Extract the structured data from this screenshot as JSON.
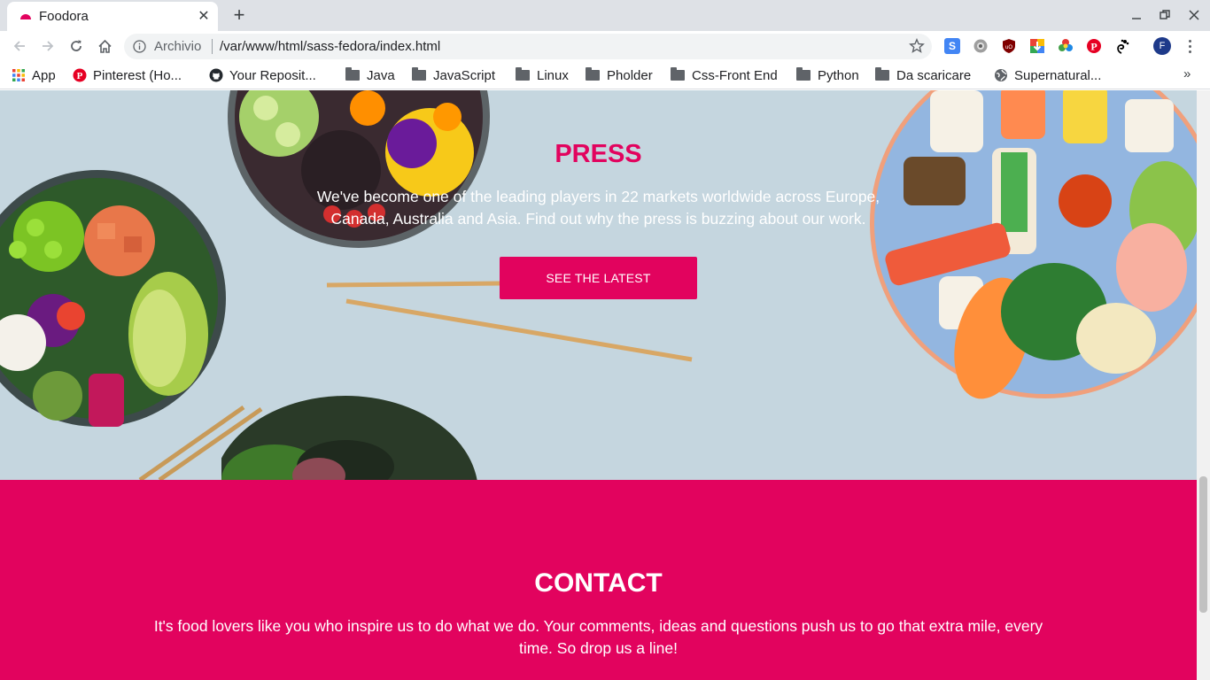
{
  "browser": {
    "tab_title": "Foodora",
    "new_tab": "+",
    "close_tab": "✕",
    "omnibox": {
      "security_label": "Archivio",
      "url": "/var/www/html/sass-fedora/index.html"
    },
    "profile_initial": "F",
    "bookmarks": [
      {
        "label": "App",
        "icon": "apps-grid-icon"
      },
      {
        "label": "Pinterest (Ho...",
        "icon": "pinterest-icon"
      },
      {
        "label": "Your Reposit...",
        "icon": "github-icon"
      },
      {
        "label": "Java",
        "icon": "folder-icon"
      },
      {
        "label": "JavaScript",
        "icon": "folder-icon"
      },
      {
        "label": "Linux",
        "icon": "folder-icon"
      },
      {
        "label": "Pholder",
        "icon": "folder-icon"
      },
      {
        "label": "Css-Front End",
        "icon": "folder-icon"
      },
      {
        "label": "Python",
        "icon": "folder-icon"
      },
      {
        "label": "Da scaricare",
        "icon": "folder-icon"
      },
      {
        "label": "Supernatural...",
        "icon": "globe-icon"
      }
    ],
    "more_bookmarks": "»"
  },
  "press": {
    "title": "PRESS",
    "text": "We've become one of the leading players in 22 markets worldwide across Europe, Canada, Australia and Asia. Find out why the press is buzzing about our work.",
    "button_label": "SEE THE LATEST"
  },
  "contact": {
    "title": "CONTACT",
    "text": "It's food lovers like you who inspire us to do what we do. Your comments, ideas and questions push us to go that extra mile, every time. So drop us a line!"
  },
  "colors": {
    "brand": "#e2035e",
    "press_bg": "#c5d6df",
    "tabstrip": "#dee1e6"
  }
}
